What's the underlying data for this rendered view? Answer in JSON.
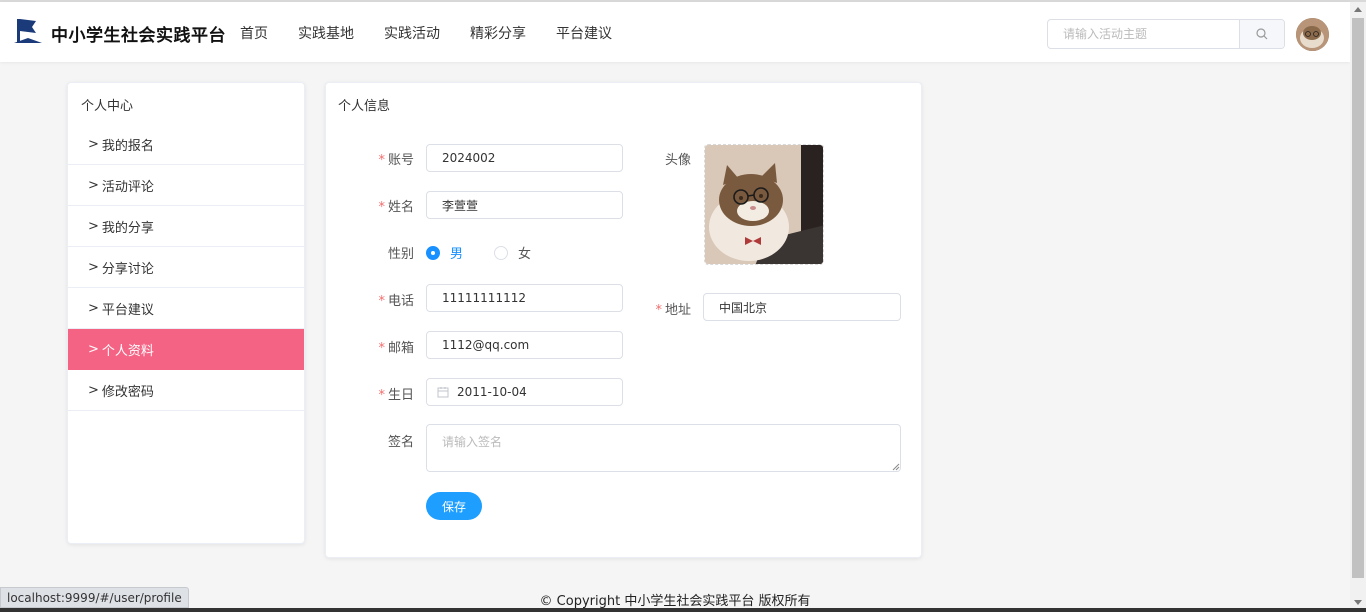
{
  "header": {
    "brand": "中小学生社会实践平台",
    "nav": [
      "首页",
      "实践基地",
      "实践活动",
      "精彩分享",
      "平台建议"
    ],
    "search_placeholder": "请输入活动主题"
  },
  "sidebar": {
    "title": "个人中心",
    "items": [
      {
        "label": "我的报名",
        "active": false
      },
      {
        "label": "活动评论",
        "active": false
      },
      {
        "label": "我的分享",
        "active": false
      },
      {
        "label": "分享讨论",
        "active": false
      },
      {
        "label": "平台建议",
        "active": false
      },
      {
        "label": "个人资料",
        "active": true
      },
      {
        "label": "修改密码",
        "active": false
      }
    ],
    "arrow": ">"
  },
  "profile": {
    "title": "个人信息",
    "account_label": "账号",
    "account": "2024002",
    "name_label": "姓名",
    "name": "李萱萱",
    "gender_label": "性别",
    "gender_male": "男",
    "gender_female": "女",
    "gender_selected": "男",
    "avatar_label": "头像",
    "phone_label": "电话",
    "phone": "11111111112",
    "address_label": "地址",
    "address": "中国北京",
    "email_label": "邮箱",
    "email": "1112@qq.com",
    "birthday_label": "生日",
    "birthday": "2011-10-04",
    "signature_label": "签名",
    "signature_placeholder": "请输入签名",
    "required_mark": "*",
    "save": "保存"
  },
  "footer": "© Copyright 中小学生社会实践平台 版权所有",
  "status_url": "localhost:9999/#/user/profile",
  "colors": {
    "active": "#f56384",
    "primary": "#1e9fff",
    "radio": "#1890ff",
    "required": "#f56c6c"
  }
}
